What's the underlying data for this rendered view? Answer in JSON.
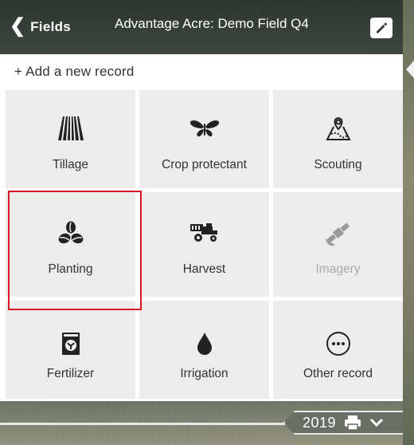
{
  "header": {
    "back_label": "Fields",
    "title": "Advantage Acre: Demo Field Q4"
  },
  "panel": {
    "add_record_label": "+ Add a new record"
  },
  "tiles": [
    {
      "label": "Tillage",
      "icon": "tillage-icon",
      "disabled": false
    },
    {
      "label": "Crop protectant",
      "icon": "butterfly-icon",
      "disabled": false
    },
    {
      "label": "Scouting",
      "icon": "map-pin-icon",
      "disabled": false
    },
    {
      "label": "Planting",
      "icon": "seeds-icon",
      "disabled": false,
      "highlighted": true
    },
    {
      "label": "Harvest",
      "icon": "combine-harvester-icon",
      "disabled": false
    },
    {
      "label": "Imagery",
      "icon": "satellite-icon",
      "disabled": true
    },
    {
      "label": "Fertilizer",
      "icon": "fertilizer-bag-icon",
      "disabled": false
    },
    {
      "label": "Irrigation",
      "icon": "water-drop-icon",
      "disabled": false
    },
    {
      "label": "Other record",
      "icon": "ellipsis-circle-icon",
      "disabled": false
    }
  ],
  "footer": {
    "year": "2019"
  },
  "colors": {
    "highlight": "#d71a21",
    "tile_bg": "#ececec",
    "header_bg": "#2f3833"
  }
}
